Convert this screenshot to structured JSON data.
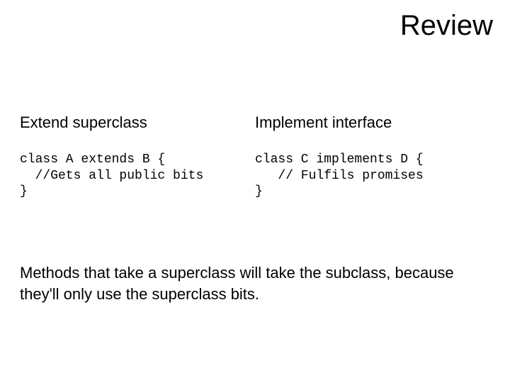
{
  "title": "Review",
  "left": {
    "heading": "Extend superclass",
    "code": "class A extends B {\n  //Gets all public bits\n}"
  },
  "right": {
    "heading": "Implement interface",
    "code": "class C implements D {\n   // Fulfils promises\n}"
  },
  "footer": "Methods that take a superclass will take the subclass, because they'll only use the superclass bits."
}
